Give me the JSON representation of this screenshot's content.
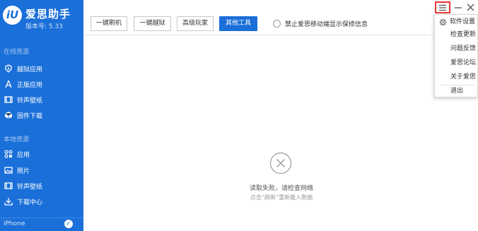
{
  "app": {
    "logo_text": "iU",
    "title": "爱思助手",
    "version": "版本号: 5.33"
  },
  "sidebar": {
    "online_section": "在线资源",
    "online_items": [
      {
        "label": "越狱应用",
        "icon": "jailbreak-apps-icon"
      },
      {
        "label": "正版应用",
        "icon": "app-store-icon"
      },
      {
        "label": "铃声壁纸",
        "icon": "ringtone-wallpaper-icon"
      },
      {
        "label": "固件下载",
        "icon": "firmware-icon"
      }
    ],
    "local_section": "本地资源",
    "local_items": [
      {
        "label": "应用",
        "icon": "apps-grid-icon"
      },
      {
        "label": "照片",
        "icon": "photo-icon"
      },
      {
        "label": "铃声壁纸",
        "icon": "ringtone-wallpaper-icon"
      },
      {
        "label": "下载中心",
        "icon": "download-icon"
      }
    ],
    "device": {
      "label": "iPhone",
      "checked": true
    }
  },
  "toolbar": {
    "buttons": [
      {
        "label": "一键刷机",
        "active": false
      },
      {
        "label": "一键越狱",
        "active": false
      },
      {
        "label": "高级玩家",
        "active": false
      },
      {
        "label": "其他工具",
        "active": true
      }
    ],
    "checkbox_label": "禁止爱思移动端显示保修信息",
    "checkbox_checked": false
  },
  "menu": {
    "items": [
      {
        "label": "软件设置",
        "icon": "gear-icon"
      },
      {
        "label": "检查更新"
      },
      {
        "label": "问题反馈"
      },
      {
        "label": "爱思论坛"
      },
      {
        "label": "关于爱思"
      },
      {
        "label": "退出"
      }
    ]
  },
  "main": {
    "error_message": "读取失败，请检查网络",
    "error_hint": "点击“刷新”重新载入数据"
  },
  "colors": {
    "sidebar": "#1a6fd9",
    "accent": "#1a6fd9",
    "highlight_border": "#e53935"
  }
}
